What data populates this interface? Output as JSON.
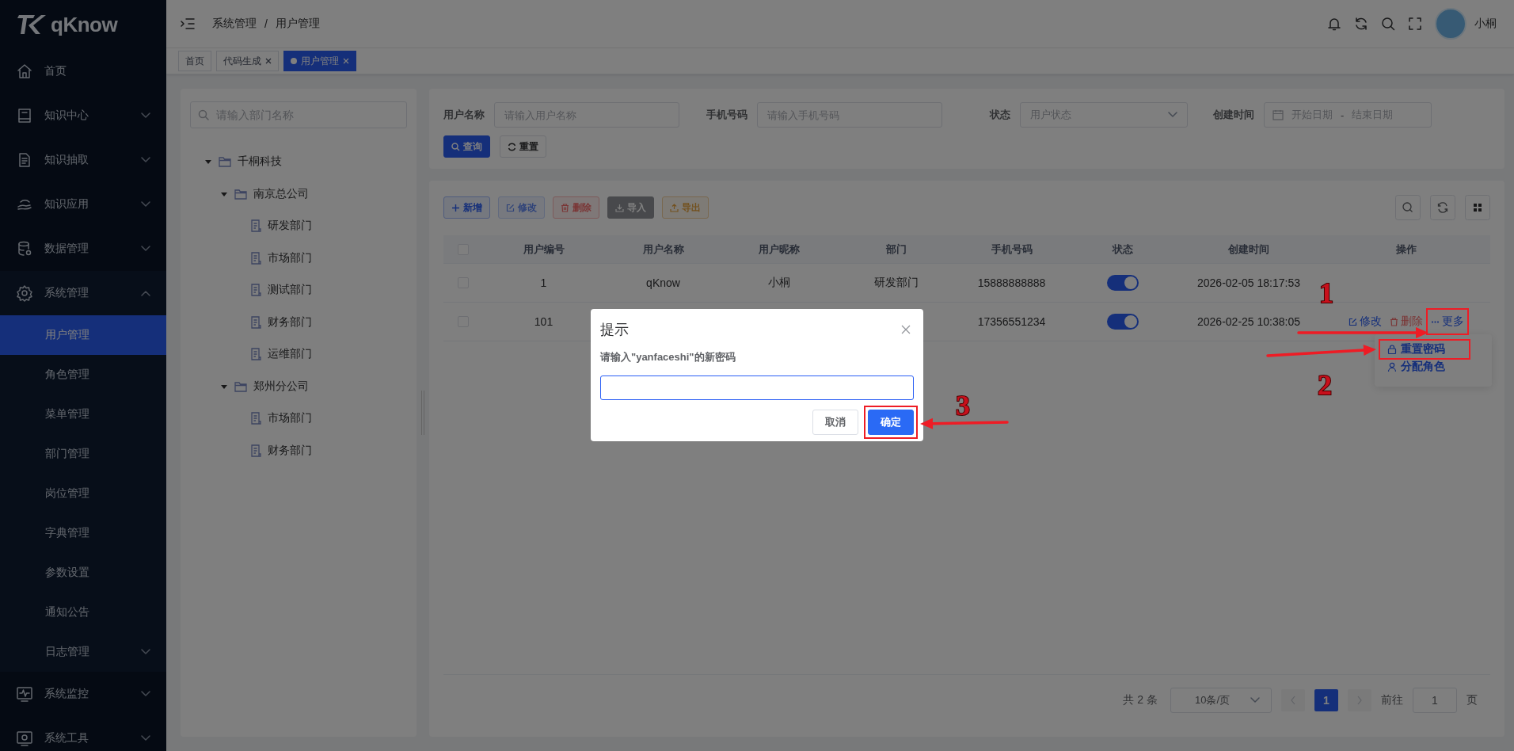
{
  "logo": {
    "text": "qKnow"
  },
  "sidebar": {
    "items": [
      {
        "label": "首页",
        "has_children": false
      },
      {
        "label": "知识中心",
        "expanded": false,
        "has_children": true
      },
      {
        "label": "知识抽取",
        "expanded": false,
        "has_children": true
      },
      {
        "label": "知识应用",
        "expanded": false,
        "has_children": true
      },
      {
        "label": "数据管理",
        "expanded": false,
        "has_children": true
      },
      {
        "label": "系统管理",
        "expanded": true,
        "has_children": true,
        "children": [
          {
            "label": "用户管理",
            "selected": true,
            "has_children": false
          },
          {
            "label": "角色管理",
            "selected": false,
            "has_children": false
          },
          {
            "label": "菜单管理",
            "selected": false,
            "has_children": false
          },
          {
            "label": "部门管理",
            "selected": false,
            "has_children": false
          },
          {
            "label": "岗位管理",
            "selected": false,
            "has_children": false
          },
          {
            "label": "字典管理",
            "selected": false,
            "has_children": false
          },
          {
            "label": "参数设置",
            "selected": false,
            "has_children": false
          },
          {
            "label": "通知公告",
            "selected": false,
            "has_children": false
          },
          {
            "label": "日志管理",
            "selected": false,
            "has_children": true
          }
        ]
      },
      {
        "label": "系统监控",
        "expanded": false,
        "has_children": true
      },
      {
        "label": "系统工具",
        "expanded": false,
        "has_children": true
      }
    ]
  },
  "header": {
    "breadcrumb": [
      "系统管理",
      "用户管理"
    ],
    "separator": "/",
    "user_name": "小桐"
  },
  "tabs": [
    {
      "label": "首页",
      "selected": false,
      "closable": false
    },
    {
      "label": "代码生成",
      "selected": false,
      "closable": true
    },
    {
      "label": "用户管理",
      "selected": true,
      "closable": true
    }
  ],
  "dept_tree": {
    "search_placeholder": "请输入部门名称",
    "nodes": [
      {
        "label": "千桐科技",
        "expanded": true,
        "children": [
          {
            "label": "南京总公司",
            "expanded": true,
            "children": [
              {
                "label": "研发部门"
              },
              {
                "label": "市场部门"
              },
              {
                "label": "测试部门"
              },
              {
                "label": "财务部门"
              },
              {
                "label": "运维部门"
              }
            ]
          },
          {
            "label": "郑州分公司",
            "expanded": true,
            "children": [
              {
                "label": "市场部门"
              },
              {
                "label": "财务部门"
              }
            ]
          }
        ]
      }
    ]
  },
  "filters": [
    {
      "kind": "input",
      "label": "用户名称",
      "placeholder": "请输入用户名称"
    },
    {
      "kind": "input",
      "label": "手机号码",
      "placeholder": "请输入手机号码"
    },
    {
      "kind": "select",
      "label": "状态",
      "placeholder": "用户状态"
    },
    {
      "kind": "daterange",
      "label": "创建时间",
      "start_placeholder": "开始日期",
      "separator": "-",
      "end_placeholder": "结束日期"
    }
  ],
  "filter_buttons": [
    {
      "kind": "primary",
      "label": "查询"
    },
    {
      "kind": "default",
      "label": "重置"
    }
  ],
  "toolbar": [
    {
      "kind": "add",
      "label": "新增",
      "disabled": false
    },
    {
      "kind": "edit",
      "label": "修改",
      "disabled": true
    },
    {
      "kind": "delete",
      "label": "删除",
      "disabled": false
    },
    {
      "kind": "import",
      "label": "导入",
      "disabled": false
    },
    {
      "kind": "export",
      "label": "导出",
      "disabled": false
    }
  ],
  "table": {
    "columns": [
      "用户编号",
      "用户名称",
      "用户昵称",
      "部门",
      "手机号码",
      "状态",
      "创建时间",
      "操作"
    ],
    "header_checked": false,
    "rows": [
      {
        "checked": false,
        "id": "1",
        "username": "qKnow",
        "nickname": "小桐",
        "dept": "研发部门",
        "phone": "15888888888",
        "status_on": true,
        "created": "2026-02-05 18:17:53",
        "actions": []
      },
      {
        "checked": false,
        "id": "101",
        "phone": "17356551234",
        "status_on": true,
        "created": "2026-02-25 10:38:05",
        "actions": [
          {
            "kind": "edit",
            "label": "修改"
          },
          {
            "kind": "delete",
            "label": "删除"
          },
          {
            "kind": "more",
            "label": "更多"
          }
        ]
      }
    ]
  },
  "more_menu": [
    {
      "kind": "lock",
      "label": "重置密码"
    },
    {
      "kind": "user",
      "label": "分配角色"
    }
  ],
  "pagination": {
    "total": "共 2 条",
    "page_size": "10条/页",
    "pages": [
      {
        "label": "1",
        "selected": true
      }
    ],
    "goto_label": "前往",
    "goto_value": "1",
    "goto_suffix": "页"
  },
  "dialog": {
    "title": "提示",
    "message": "请输入\"yanfaceshi\"的新密码",
    "buttons": [
      {
        "kind": "cancel",
        "label": "取消"
      },
      {
        "kind": "confirm",
        "label": "确定"
      }
    ]
  },
  "annotations": {
    "steps": [
      "1",
      "2",
      "3"
    ]
  }
}
